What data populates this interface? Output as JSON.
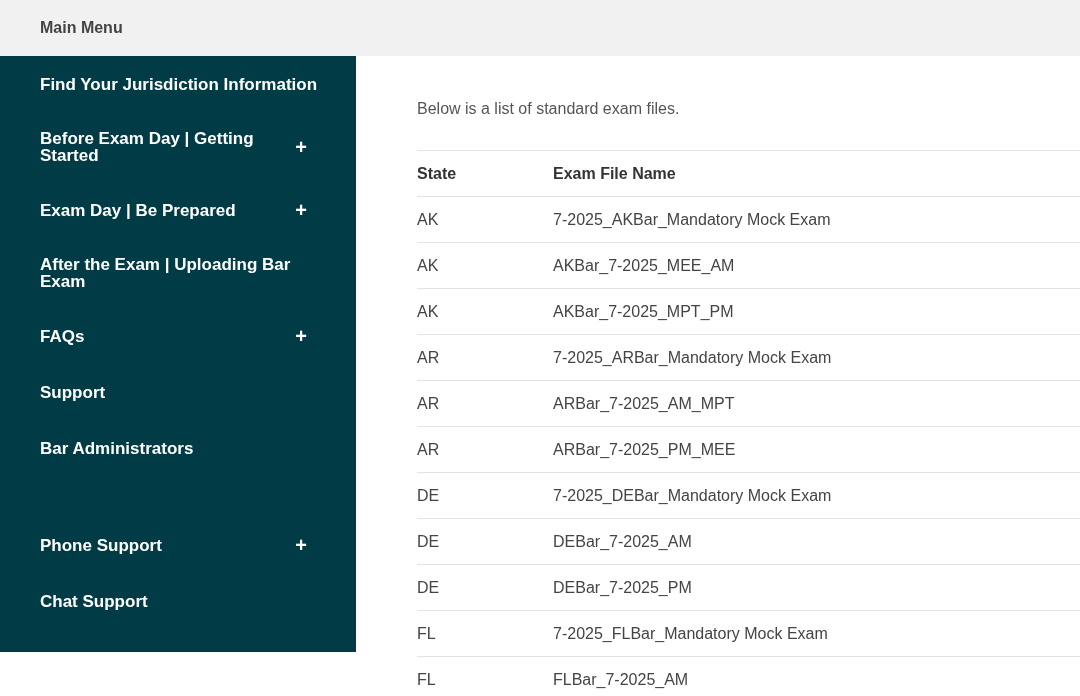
{
  "header": {
    "title": "Main Menu"
  },
  "menu": [
    {
      "label": "Find Your Jurisdiction Information"
    },
    {
      "label": "Before Exam Day | Getting Started",
      "toggle": "+"
    },
    {
      "label": "Exam Day | Be Prepared",
      "toggle": "+"
    },
    {
      "label": "After the Exam | Uploading Bar Exam"
    },
    {
      "label": "FAQs",
      "toggle": "+"
    },
    {
      "label": "Support"
    },
    {
      "label": "Bar Administrators"
    }
  ],
  "support_menu": [
    {
      "label": "Phone Support",
      "toggle": "+"
    },
    {
      "label": "Chat Support"
    }
  ],
  "intro": "Below is a list of standard exam files.",
  "table": {
    "columns": [
      "State",
      "Exam File Name"
    ],
    "rows": [
      [
        "AK",
        "7-2025_AKBar_Mandatory Mock Exam"
      ],
      [
        "AK",
        "AKBar_7-2025_MEE_AM"
      ],
      [
        "AK",
        "AKBar_7-2025_MPT_PM"
      ],
      [
        "AR",
        "7-2025_ARBar_Mandatory Mock Exam"
      ],
      [
        "AR",
        "ARBar_7-2025_AM_MPT"
      ],
      [
        "AR",
        "ARBar_7-2025_PM_MEE"
      ],
      [
        "DE",
        "7-2025_DEBar_Mandatory Mock Exam"
      ],
      [
        "DE",
        "DEBar_7-2025_AM"
      ],
      [
        "DE",
        "DEBar_7-2025_PM"
      ],
      [
        "FL",
        "7-2025_FLBar_Mandatory Mock Exam"
      ],
      [
        "FL",
        "FLBar_7-2025_AM"
      ]
    ]
  }
}
